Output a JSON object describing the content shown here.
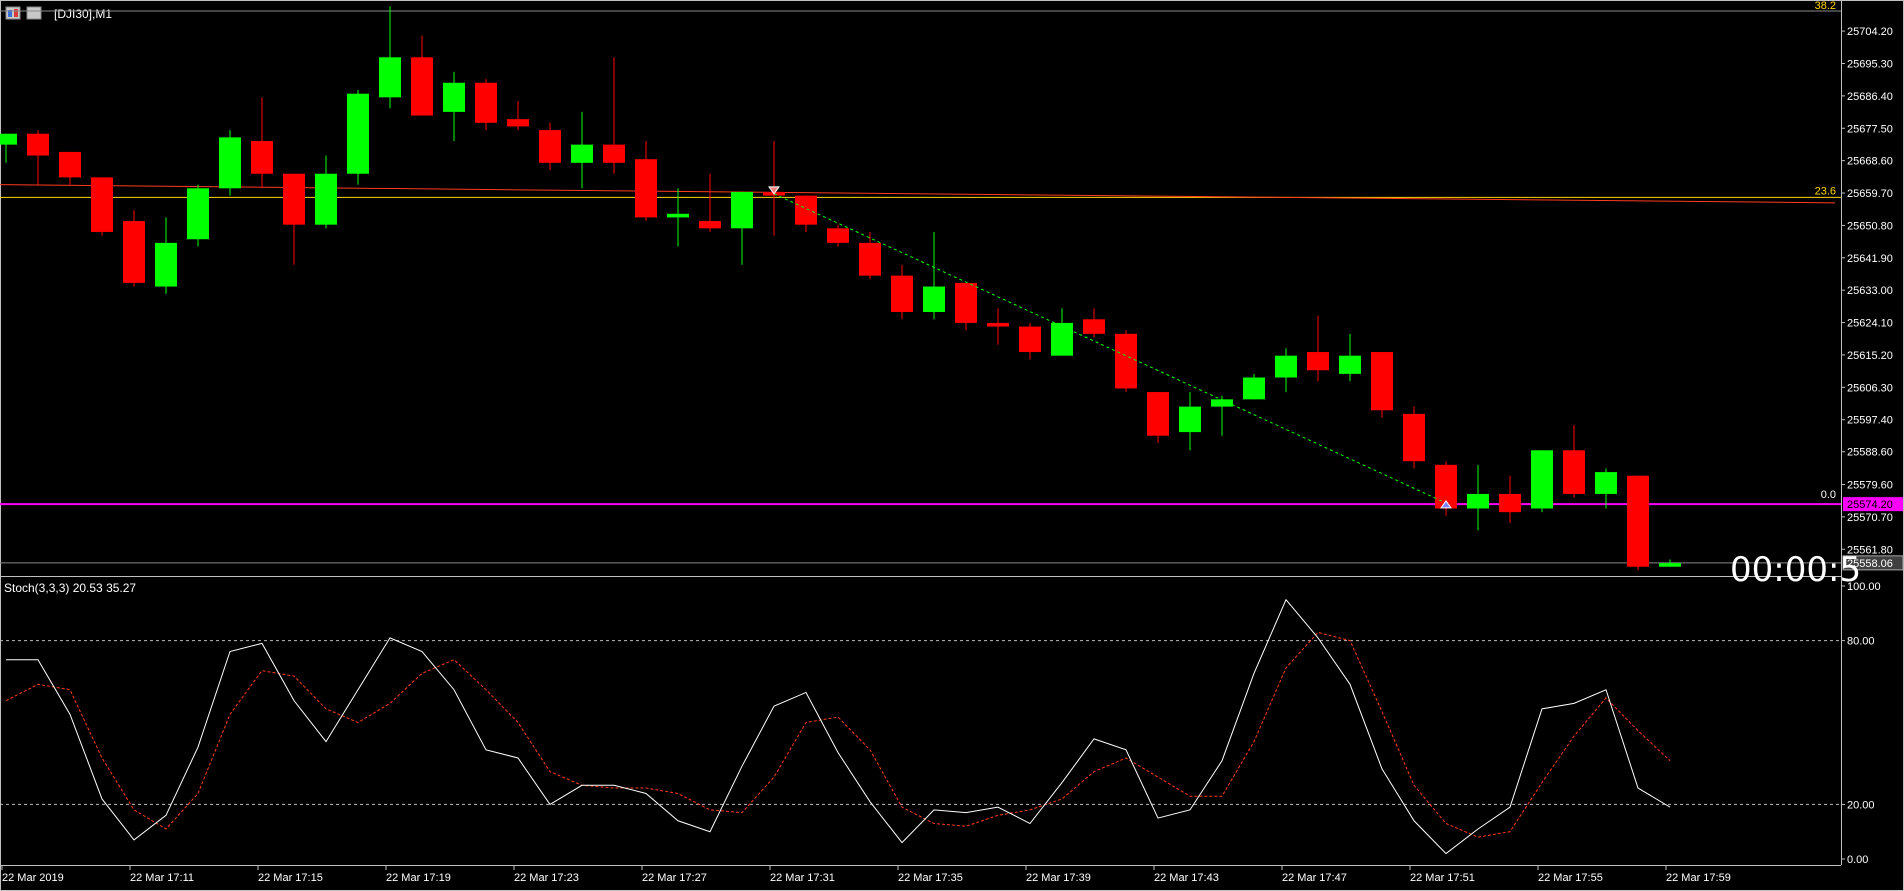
{
  "window": {
    "symbol_label": "[DJI30],M1",
    "countdown": "00:00:5"
  },
  "colors": {
    "background": "#000000",
    "bull_candle": "#00ff00",
    "bear_candle": "#ff0000",
    "wick": "#b0b0b0",
    "grid_text": "#ffffff",
    "frame": "#c0c0c0",
    "fib_line": "#ffd700",
    "ma_line": "#ff3b1f",
    "magenta_line": "#ff00ff",
    "trend_line": "#00ff00",
    "stoch_main": "#ffffff",
    "stoch_signal": "#ff3b1f",
    "price_label_bg": "#404040"
  },
  "price_axis": {
    "ticks": [
      "25704.20",
      "25695.30",
      "25686.40",
      "25677.50",
      "25668.60",
      "25659.70",
      "25650.80",
      "25641.90",
      "25633.00",
      "25624.10",
      "25615.20",
      "25606.30",
      "25597.40",
      "25588.60",
      "25579.60",
      "25570.70",
      "25561.80"
    ],
    "fib_labels": {
      "top": "38.2",
      "mid": "23.6",
      "bottom": "0.0"
    },
    "magenta_price_label": "25574.20",
    "current_price_label": "25558.06"
  },
  "stoch": {
    "label": "Stoch(3,3,3) 20.53 35.27",
    "ticks": [
      "100.00",
      "80.00",
      "20.00",
      "0.00"
    ]
  },
  "time_axis": {
    "labels": [
      "22 Mar 2019",
      "22 Mar 17:11",
      "22 Mar 17:15",
      "22 Mar 17:19",
      "22 Mar 17:23",
      "22 Mar 17:27",
      "22 Mar 17:31",
      "22 Mar 17:35",
      "22 Mar 17:39",
      "22 Mar 17:43",
      "22 Mar 17:47",
      "22 Mar 17:51",
      "22 Mar 17:55",
      "22 Mar 17:59"
    ]
  },
  "chart_data": [
    {
      "type": "candlestick",
      "symbol": "[DJI30]",
      "timeframe": "M1",
      "ylim": [
        25555,
        25710
      ],
      "fib_levels": [
        {
          "label": "38.2",
          "price": 25710
        },
        {
          "label": "23.6",
          "price": 25658.5
        },
        {
          "label": "0.0",
          "price": 25574.2
        }
      ],
      "horizontal_lines": [
        {
          "price": 25574.2,
          "label": "25574.20"
        },
        {
          "price": 25558.06,
          "label": "25558.06"
        }
      ],
      "moving_average": [
        25662,
        25657
      ],
      "trend_line": {
        "from": [
          24,
          25659.5
        ],
        "to": [
          45,
          25574.5
        ]
      },
      "arrows": [
        {
          "index": 24,
          "price": 25660,
          "dir": "down"
        },
        {
          "index": 45,
          "price": 25574,
          "dir": "up"
        }
      ],
      "candles": [
        {
          "o": 25673,
          "h": 25676,
          "l": 25668,
          "c": 25676
        },
        {
          "o": 25676,
          "h": 25677,
          "l": 25662,
          "c": 25670
        },
        {
          "o": 25671,
          "h": 25671,
          "l": 25662,
          "c": 25664
        },
        {
          "o": 25664,
          "h": 25664,
          "l": 25648,
          "c": 25649
        },
        {
          "o": 25652,
          "h": 25655,
          "l": 25634,
          "c": 25635
        },
        {
          "o": 25634,
          "h": 25653,
          "l": 25632,
          "c": 25646
        },
        {
          "o": 25647,
          "h": 25662,
          "l": 25645,
          "c": 25661
        },
        {
          "o": 25661,
          "h": 25677,
          "l": 25659,
          "c": 25675
        },
        {
          "o": 25674,
          "h": 25686,
          "l": 25661,
          "c": 25665
        },
        {
          "o": 25665,
          "h": 25665,
          "l": 25640,
          "c": 25651
        },
        {
          "o": 25651,
          "h": 25670,
          "l": 25650,
          "c": 25665
        },
        {
          "o": 25665,
          "h": 25688,
          "l": 25662,
          "c": 25687
        },
        {
          "o": 25686,
          "h": 25711,
          "l": 25683,
          "c": 25697
        },
        {
          "o": 25697,
          "h": 25703,
          "l": 25682,
          "c": 25681
        },
        {
          "o": 25682,
          "h": 25693,
          "l": 25674,
          "c": 25690
        },
        {
          "o": 25690,
          "h": 25691,
          "l": 25677,
          "c": 25679
        },
        {
          "o": 25680,
          "h": 25685,
          "l": 25677,
          "c": 25678
        },
        {
          "o": 25677,
          "h": 25679,
          "l": 25666,
          "c": 25668
        },
        {
          "o": 25668,
          "h": 25682,
          "l": 25661,
          "c": 25673
        },
        {
          "o": 25673,
          "h": 25697,
          "l": 25665,
          "c": 25668
        },
        {
          "o": 25669,
          "h": 25674,
          "l": 25652,
          "c": 25653
        },
        {
          "o": 25653,
          "h": 25661,
          "l": 25645,
          "c": 25654
        },
        {
          "o": 25652,
          "h": 25665,
          "l": 25649,
          "c": 25650
        },
        {
          "o": 25650,
          "h": 25660,
          "l": 25640,
          "c": 25660
        },
        {
          "o": 25660,
          "h": 25674,
          "l": 25648,
          "c": 25659
        },
        {
          "o": 25659,
          "h": 25659,
          "l": 25649,
          "c": 25651
        },
        {
          "o": 25650,
          "h": 25651,
          "l": 25645,
          "c": 25646
        },
        {
          "o": 25646,
          "h": 25649,
          "l": 25636,
          "c": 25637
        },
        {
          "o": 25637,
          "h": 25640,
          "l": 25625,
          "c": 25627
        },
        {
          "o": 25627,
          "h": 25649,
          "l": 25625,
          "c": 25634
        },
        {
          "o": 25635,
          "h": 25635,
          "l": 25622,
          "c": 25624
        },
        {
          "o": 25624,
          "h": 25628,
          "l": 25618,
          "c": 25623
        },
        {
          "o": 25623,
          "h": 25624,
          "l": 25614,
          "c": 25616
        },
        {
          "o": 25615,
          "h": 25628,
          "l": 25615,
          "c": 25624
        },
        {
          "o": 25625,
          "h": 25628,
          "l": 25620,
          "c": 25621
        },
        {
          "o": 25621,
          "h": 25622,
          "l": 25605,
          "c": 25606
        },
        {
          "o": 25605,
          "h": 25605,
          "l": 25591,
          "c": 25593
        },
        {
          "o": 25594,
          "h": 25605,
          "l": 25589,
          "c": 25601
        },
        {
          "o": 25601,
          "h": 25604,
          "l": 25593,
          "c": 25603
        },
        {
          "o": 25603,
          "h": 25610,
          "l": 25603,
          "c": 25609
        },
        {
          "o": 25609,
          "h": 25617,
          "l": 25605,
          "c": 25615
        },
        {
          "o": 25616,
          "h": 25626,
          "l": 25608,
          "c": 25611
        },
        {
          "o": 25610,
          "h": 25621,
          "l": 25608,
          "c": 25615
        },
        {
          "o": 25616,
          "h": 25616,
          "l": 25598,
          "c": 25600
        },
        {
          "o": 25599,
          "h": 25601,
          "l": 25584,
          "c": 25586
        },
        {
          "o": 25585,
          "h": 25586,
          "l": 25571,
          "c": 25573
        },
        {
          "o": 25573,
          "h": 25585,
          "l": 25567,
          "c": 25577
        },
        {
          "o": 25577,
          "h": 25582,
          "l": 25569,
          "c": 25572
        },
        {
          "o": 25573,
          "h": 25589,
          "l": 25572,
          "c": 25589
        },
        {
          "o": 25589,
          "h": 25596,
          "l": 25576,
          "c": 25577
        },
        {
          "o": 25577,
          "h": 25584,
          "l": 25573,
          "c": 25583
        },
        {
          "o": 25582,
          "h": 25582,
          "l": 25556,
          "c": 25557
        },
        {
          "o": 25557,
          "h": 25559,
          "l": 25557,
          "c": 25558
        }
      ]
    },
    {
      "type": "line",
      "title": "Stoch(3,3,3) 20.53 35.27",
      "ylim": [
        0,
        100
      ],
      "levels": [
        80,
        20
      ],
      "series": [
        {
          "values": [
            73,
            73,
            53,
            22,
            7,
            16,
            41,
            76,
            79,
            58,
            43,
            62,
            81,
            76,
            62,
            40,
            37,
            20,
            27,
            27,
            24,
            14,
            10,
            34,
            56,
            61,
            39,
            21,
            6,
            18,
            17,
            19,
            13,
            28,
            44,
            40,
            15,
            18,
            36,
            68,
            95,
            81,
            64,
            33,
            14,
            2,
            11,
            19,
            55,
            57,
            62,
            26,
            19
          ]
        },
        {
          "values": [
            58,
            64,
            62,
            37,
            18,
            11,
            24,
            53,
            69,
            67,
            55,
            50,
            57,
            68,
            73,
            62,
            50,
            32,
            27,
            26,
            26,
            24,
            18,
            17,
            30,
            50,
            52,
            40,
            19,
            13,
            12,
            16,
            18,
            22,
            32,
            37,
            30,
            23,
            23,
            43,
            70,
            83,
            80,
            54,
            27,
            13,
            8,
            10,
            28,
            45,
            59,
            47,
            36
          ]
        }
      ]
    }
  ]
}
